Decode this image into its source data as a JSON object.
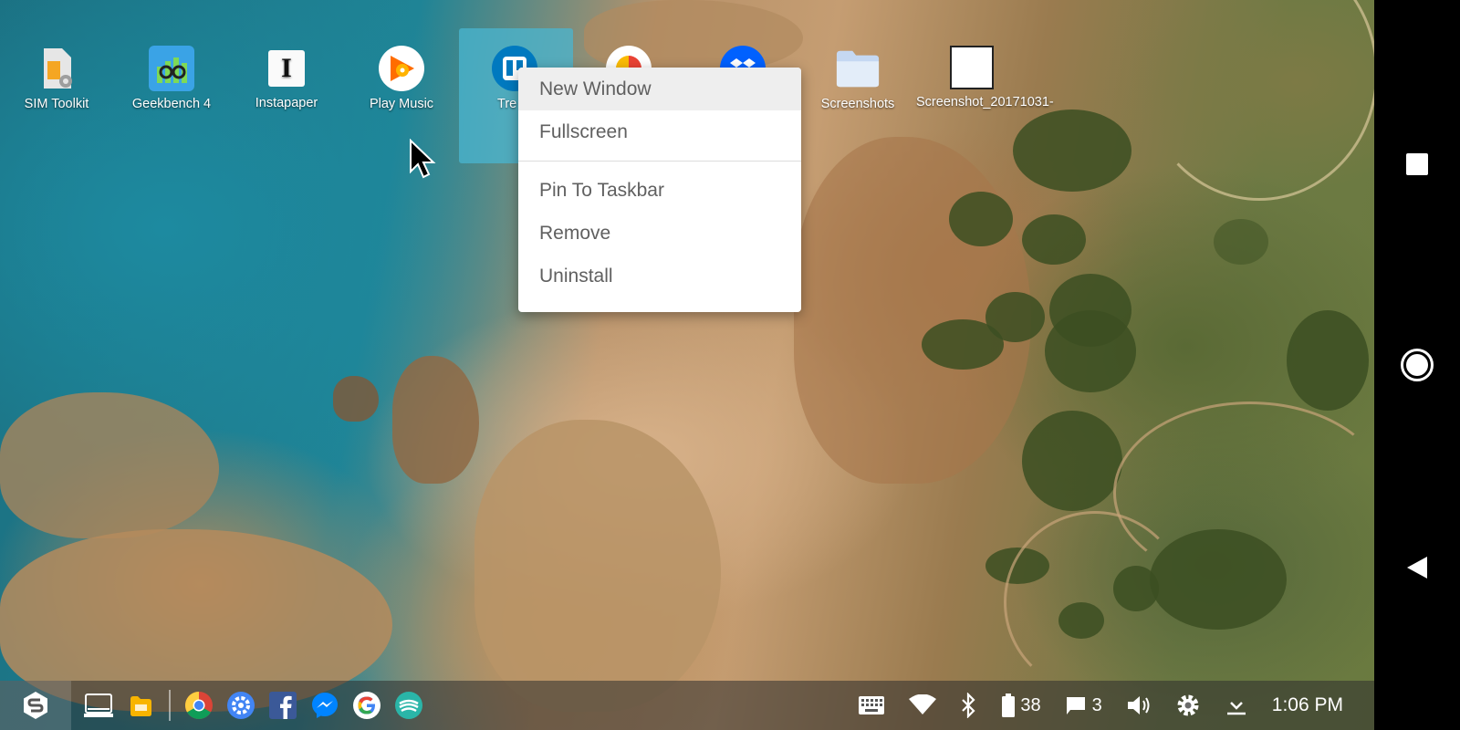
{
  "desktop": {
    "icons": [
      {
        "label": "SIM Toolkit",
        "icon": "sim-toolkit-icon"
      },
      {
        "label": "Geekbench 4",
        "icon": "geekbench-icon"
      },
      {
        "label": "Instapaper",
        "icon": "instapaper-icon",
        "glyph": "I"
      },
      {
        "label": "Play Music",
        "icon": "play-music-icon"
      },
      {
        "label": "Tre",
        "icon": "trello-icon"
      },
      {
        "label": "",
        "icon": "photos-app-icon"
      },
      {
        "label": "",
        "icon": "dropbox-icon"
      },
      {
        "label": "Screenshots",
        "icon": "folder-icon"
      },
      {
        "label": "Screenshot_20171031-",
        "icon": "image-file-icon"
      }
    ]
  },
  "context_menu": {
    "items": [
      "New Window",
      "Fullscreen",
      "Pin To Taskbar",
      "Remove",
      "Uninstall"
    ]
  },
  "taskbar": {
    "apps": [
      "start-menu-icon",
      "desktop-mode-icon",
      "files-icon",
      "chrome-icon",
      "settings-app-icon",
      "facebook-icon",
      "messenger-icon",
      "google-icon",
      "swiftkey-icon"
    ],
    "tray": {
      "battery": "38",
      "notifications": "3",
      "time": "1:06 PM"
    }
  },
  "colors": {
    "menu_text": "#606060",
    "selection": "#4ab6d0",
    "navbar": "#000000"
  }
}
